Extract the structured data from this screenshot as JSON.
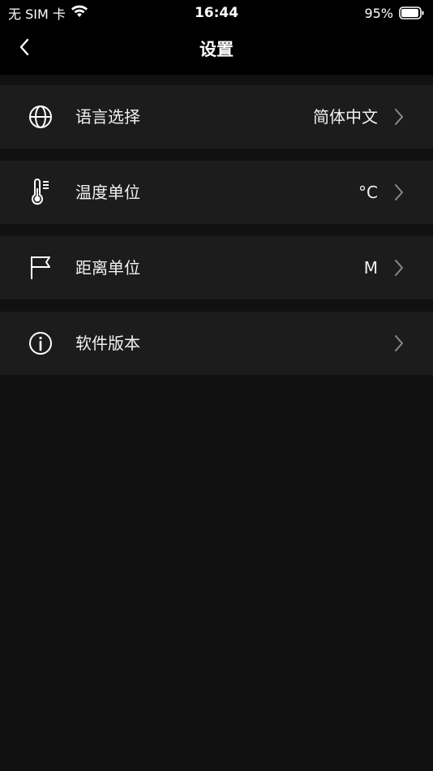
{
  "status_bar": {
    "carrier": "无 SIM 卡",
    "time": "16:44",
    "battery": "95%",
    "battery_level": 0.95
  },
  "nav": {
    "title": "设置",
    "back_icon": "chevron-left-icon"
  },
  "settings": [
    {
      "icon": "globe-icon",
      "label": "语言选择",
      "value": "简体中文"
    },
    {
      "icon": "thermometer-icon",
      "label": "温度单位",
      "value": "°C"
    },
    {
      "icon": "flag-icon",
      "label": "距离单位",
      "value": "M"
    },
    {
      "icon": "info-icon",
      "label": "软件版本",
      "value": ""
    }
  ],
  "colors": {
    "background": "#111111",
    "bar": "#000000",
    "row": "#1c1c1c",
    "chevron": "#8a8a8a"
  }
}
